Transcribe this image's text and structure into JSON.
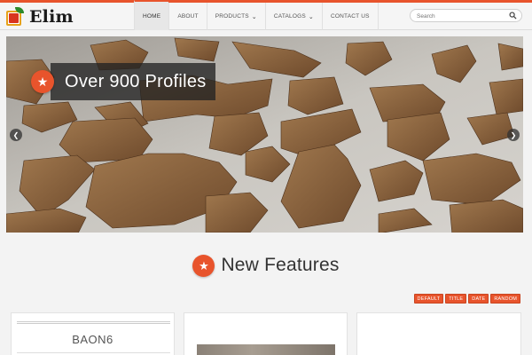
{
  "brand": {
    "name": "Elim",
    "accent": "#e8542c"
  },
  "nav": {
    "items": [
      {
        "label": "HOME",
        "active": true,
        "dropdown": false
      },
      {
        "label": "ABOUT",
        "active": false,
        "dropdown": false
      },
      {
        "label": "PRODUCTS",
        "active": false,
        "dropdown": true
      },
      {
        "label": "CATALOGS",
        "active": false,
        "dropdown": true
      },
      {
        "label": "CONTACT US",
        "active": false,
        "dropdown": false
      }
    ]
  },
  "search": {
    "placeholder": "Search",
    "icon": "search-icon"
  },
  "slider": {
    "caption": "Over 900 Profiles",
    "caption_icon": "star-icon",
    "prev_icon": "chevron-left-icon",
    "next_icon": "chevron-right-icon"
  },
  "features": {
    "title": "New Features",
    "icon": "star-icon",
    "filters": [
      "DEFAULT",
      "TITLE",
      "DATE",
      "RANDOM"
    ],
    "cards": [
      {
        "title": "BAON6"
      },
      {
        "title": ""
      },
      {
        "title": ""
      }
    ]
  }
}
